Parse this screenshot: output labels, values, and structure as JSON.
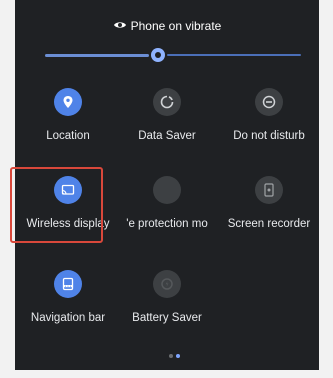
{
  "header": {
    "title": "Phone on vibrate",
    "icon": "vibrate-icon"
  },
  "brightness": {
    "level": 0.44
  },
  "tiles": [
    {
      "label": "Location",
      "icon": "location-icon",
      "active": true
    },
    {
      "label": "Data Saver",
      "icon": "data-saver-icon",
      "active": false
    },
    {
      "label": "Do not disturb",
      "icon": "do-not-disturb-icon",
      "active": false
    },
    {
      "label": "Wireless display",
      "icon": "cast-icon",
      "active": true
    },
    {
      "label": "'e protection mo",
      "icon": "eye-protection-icon",
      "active": false
    },
    {
      "label": "Screen recorder",
      "icon": "screen-recorder-icon",
      "active": false
    },
    {
      "label": "Navigation bar",
      "icon": "navigation-bar-icon",
      "active": true
    },
    {
      "label": "Battery Saver",
      "icon": "battery-saver-icon",
      "active": false
    }
  ],
  "pagination": {
    "pages": 2,
    "current": 2
  },
  "colors": {
    "panel": "#1f2124",
    "accent": "#4f83e8",
    "tile_off": "#3d4043",
    "highlight": "#d9483b"
  }
}
